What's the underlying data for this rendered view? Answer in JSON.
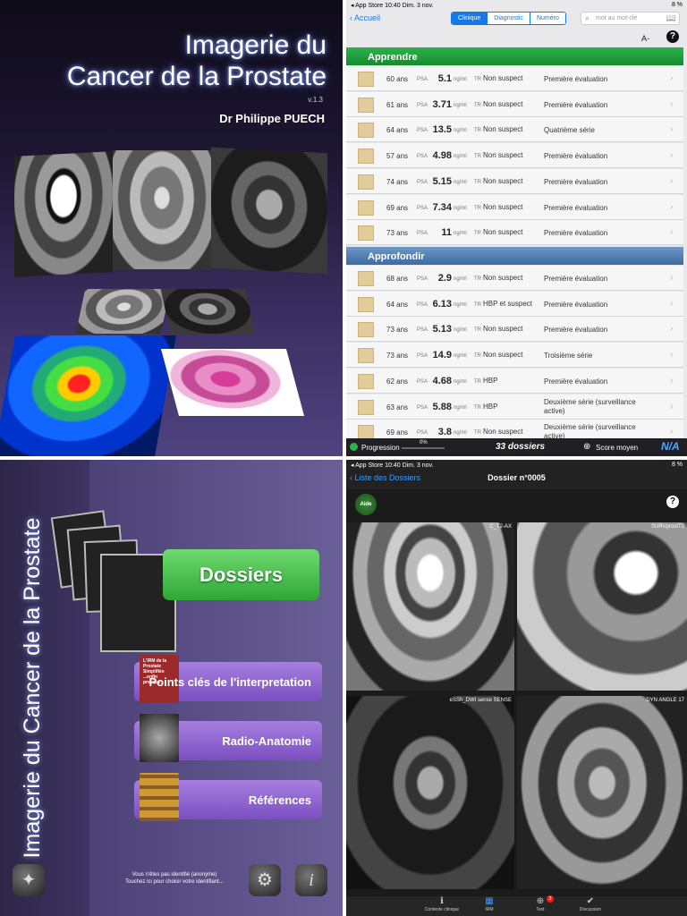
{
  "panel1": {
    "title_line1": "Imagerie du",
    "title_line2": "Cancer de la Prostate",
    "version": "v.1.3",
    "author": "Dr Philippe PUECH"
  },
  "panel2": {
    "status_left": "◂ App Store  10:40  Dim. 3 nov.",
    "status_right": "8 %",
    "back_label": "Accueil",
    "tabs": [
      "Clinique",
      "Diagnostic",
      "Numéro"
    ],
    "search_placeholder": "mot au mot-clé",
    "font_toggle": "A-",
    "section_learn": "Apprendre",
    "section_deepen": "Approfondir",
    "psa_label": "PSA",
    "psa_unit": "ng/ml",
    "tr_label": "TR",
    "rows_learn": [
      {
        "age": "60 ans",
        "psa": "5.1",
        "tr": "Non suspect",
        "eval": "Première évaluation"
      },
      {
        "age": "61 ans",
        "psa": "3.71",
        "tr": "Non suspect",
        "eval": "Première évaluation"
      },
      {
        "age": "64 ans",
        "psa": "13.5",
        "tr": "Non suspect",
        "eval": "Quatrième série"
      },
      {
        "age": "57 ans",
        "psa": "4.98",
        "tr": "Non suspect",
        "eval": "Première évaluation"
      },
      {
        "age": "74 ans",
        "psa": "5.15",
        "tr": "Non suspect",
        "eval": "Première évaluation"
      },
      {
        "age": "69 ans",
        "psa": "7.34",
        "tr": "Non suspect",
        "eval": "Première évaluation"
      },
      {
        "age": "73 ans",
        "psa": "11",
        "tr": "Non suspect",
        "eval": "Première évaluation"
      }
    ],
    "rows_deepen": [
      {
        "age": "68 ans",
        "psa": "2.9",
        "tr": "Non suspect",
        "eval": "Première évaluation"
      },
      {
        "age": "64 ans",
        "psa": "6.13",
        "tr": "HBP et suspect",
        "eval": "Première évaluation"
      },
      {
        "age": "73 ans",
        "psa": "5.13",
        "tr": "Non suspect",
        "eval": "Première évaluation"
      },
      {
        "age": "73 ans",
        "psa": "14.9",
        "tr": "Non suspect",
        "eval": "Troisième série"
      },
      {
        "age": "62 ans",
        "psa": "4.68",
        "tr": "HBP",
        "eval": "Première évaluation"
      },
      {
        "age": "63 ans",
        "psa": "5.88",
        "tr": "HBP",
        "eval": "Deuxième série (surveillance active)"
      },
      {
        "age": "69 ans",
        "psa": "3.8",
        "tr": "Non suspect",
        "eval": "Deuxième série (surveillance active)"
      }
    ],
    "footer": {
      "progress_label": "Progression",
      "progress_pct": "0%",
      "progress_value": 0,
      "count": "33 dossiers",
      "score_label": "Score moyen",
      "logo": "N/A"
    }
  },
  "panel3": {
    "vertical_title": "Imagerie du Cancer de la Prostate",
    "btn_dossiers": "Dossiers",
    "btn_points": "Points clés de l'interpretation",
    "btn_anatomy": "Radio-Anatomie",
    "btn_refs": "Références",
    "book_text": "L'IRM de la Prostate Simplifiée ...enfin presque",
    "note_line1": "Vous n'êtes pas identifié (anonyme)",
    "note_line2": "Touchez ici pour choisir votre identifiant..."
  },
  "panel4": {
    "status_left": "◂ App Store  10:40  Dim. 3 nov.",
    "status_right": "8 %",
    "back_label": "Liste des Dossiers",
    "title": "Dossier n°0005",
    "aide": "Aide",
    "seq_tl": "C_T2-AX",
    "seq_tr": "SURVprostT2",
    "seq_bl": "eSSh_DWI sense SENSE",
    "seq_br": "DYN ANGLE 17",
    "tabs": [
      "Contexte clinique",
      "IRM",
      "Test",
      "Discussion"
    ],
    "test_badge": "2"
  }
}
